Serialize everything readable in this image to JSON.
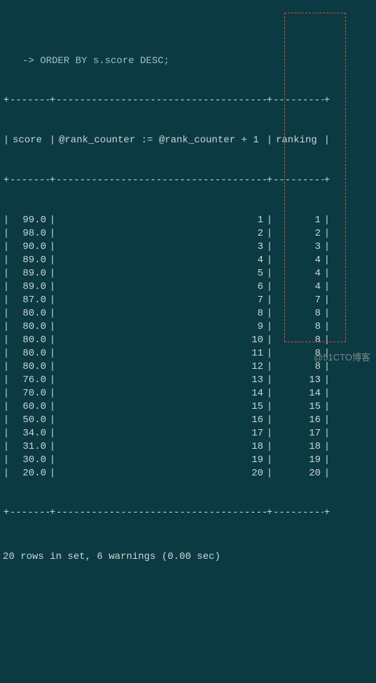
{
  "sql_fragment": "-> ORDER BY s.score DESC;",
  "columns": {
    "c1": "score",
    "c2": "@rank_counter := @rank_counter + 1",
    "c3": "ranking"
  },
  "rows": [
    {
      "score": "99.0",
      "counter": "1",
      "ranking": "1"
    },
    {
      "score": "98.0",
      "counter": "2",
      "ranking": "2"
    },
    {
      "score": "90.0",
      "counter": "3",
      "ranking": "3"
    },
    {
      "score": "89.0",
      "counter": "4",
      "ranking": "4"
    },
    {
      "score": "89.0",
      "counter": "5",
      "ranking": "4"
    },
    {
      "score": "89.0",
      "counter": "6",
      "ranking": "4"
    },
    {
      "score": "87.0",
      "counter": "7",
      "ranking": "7"
    },
    {
      "score": "80.0",
      "counter": "8",
      "ranking": "8"
    },
    {
      "score": "80.0",
      "counter": "9",
      "ranking": "8"
    },
    {
      "score": "80.0",
      "counter": "10",
      "ranking": "8"
    },
    {
      "score": "80.0",
      "counter": "11",
      "ranking": "8"
    },
    {
      "score": "80.0",
      "counter": "12",
      "ranking": "8"
    },
    {
      "score": "76.0",
      "counter": "13",
      "ranking": "13"
    },
    {
      "score": "70.0",
      "counter": "14",
      "ranking": "14"
    },
    {
      "score": "60.0",
      "counter": "15",
      "ranking": "15"
    },
    {
      "score": "50.0",
      "counter": "16",
      "ranking": "16"
    },
    {
      "score": "34.0",
      "counter": "17",
      "ranking": "17"
    },
    {
      "score": "31.0",
      "counter": "18",
      "ranking": "18"
    },
    {
      "score": "30.0",
      "counter": "19",
      "ranking": "19"
    },
    {
      "score": "20.0",
      "counter": "20",
      "ranking": "20"
    }
  ],
  "dash": {
    "d1": "-------",
    "d2": "-------------------------------------",
    "d3": "---------"
  },
  "status_line": "20 rows in set, 6 warnings (0.00 sec)",
  "watermark": "@51CTO博客"
}
